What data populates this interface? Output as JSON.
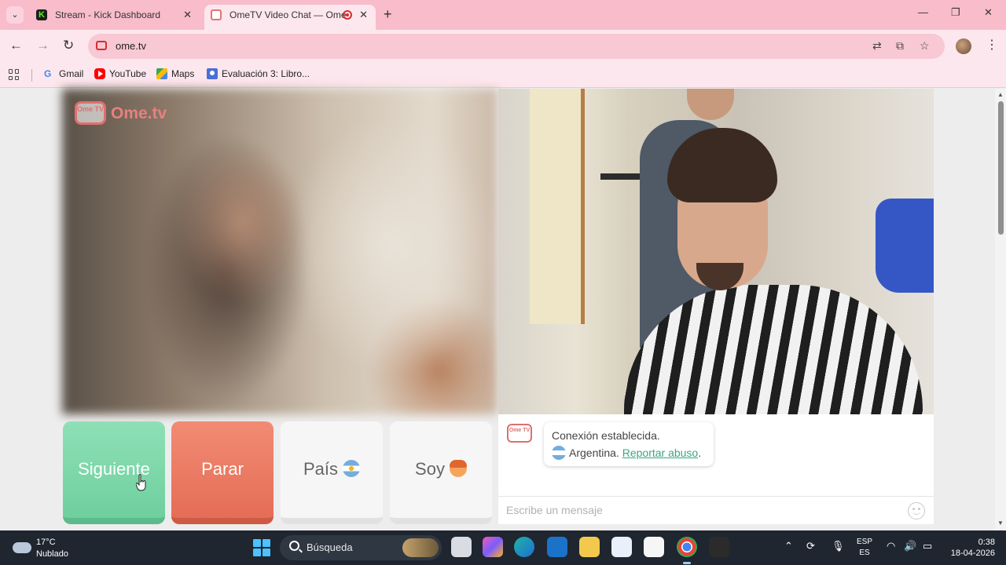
{
  "browser": {
    "tabs": [
      {
        "title": "Stream - Kick Dashboard",
        "active": false
      },
      {
        "title": "OmeTV Video Chat — Ome",
        "active": true
      }
    ],
    "url": "ome.tv",
    "bookmarks": [
      {
        "label": "Gmail",
        "icon": "google-icon"
      },
      {
        "label": "YouTube",
        "icon": "youtube-icon"
      },
      {
        "label": "Maps",
        "icon": "maps-icon"
      },
      {
        "label": "Evaluación 3: Libro...",
        "icon": "document-icon"
      }
    ]
  },
  "app": {
    "logo_text": "Ome.tv",
    "logo_badge": "Ome TV",
    "buttons": {
      "next": "Siguiente",
      "stop": "Parar",
      "country": "País",
      "gender": "Soy"
    },
    "chat": {
      "status": "Conexión establecida.",
      "country": "Argentina.",
      "report": "Reportar abuso",
      "report_suffix": ".",
      "placeholder": "Escribe un mensaje"
    }
  },
  "taskbar": {
    "weather_temp": "17°C",
    "weather_condition": "Nublado",
    "search_label": "Búsqueda",
    "language_line1": "ESP",
    "language_line2": "ES",
    "time": "0:38",
    "date": "18-04-2026"
  },
  "colors": {
    "tabbar": "#f8bccb",
    "toolbar": "#fde7ee",
    "next_button": "#7ad6a8",
    "stop_button": "#e9765f",
    "link": "#3ba584"
  }
}
